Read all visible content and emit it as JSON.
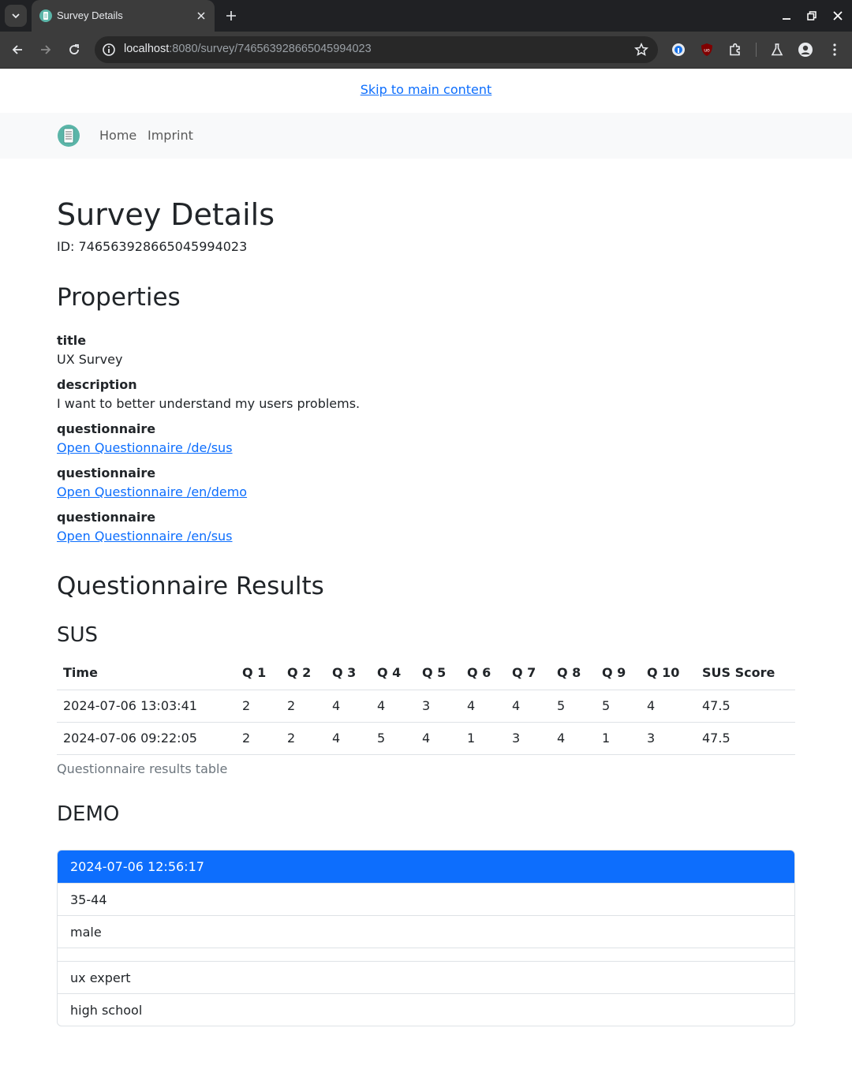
{
  "browser": {
    "tab_title": "Survey Details",
    "url_host": "localhost",
    "url_path": ":8080/survey/746563928665045994023"
  },
  "page": {
    "skip_link": "Skip to main content",
    "nav": {
      "home": "Home",
      "imprint": "Imprint"
    },
    "title": "Survey Details",
    "id_line": "ID: 746563928665045994023",
    "properties_heading": "Properties",
    "properties": [
      {
        "key": "title",
        "value": "UX Survey"
      },
      {
        "key": "description",
        "value": "I want to better understand my users problems."
      },
      {
        "key": "questionnaire",
        "link": "Open Questionnaire /de/sus"
      },
      {
        "key": "questionnaire",
        "link": "Open Questionnaire /en/demo"
      },
      {
        "key": "questionnaire",
        "link": "Open Questionnaire /en/sus"
      }
    ],
    "results_heading": "Questionnaire Results",
    "sus": {
      "heading": "SUS",
      "columns": [
        "Time",
        "Q 1",
        "Q 2",
        "Q 3",
        "Q 4",
        "Q 5",
        "Q 6",
        "Q 7",
        "Q 8",
        "Q 9",
        "Q 10",
        "SUS Score"
      ],
      "rows": [
        [
          "2024-07-06 13:03:41",
          "2",
          "2",
          "4",
          "4",
          "3",
          "4",
          "4",
          "5",
          "5",
          "4",
          "47.5"
        ],
        [
          "2024-07-06 09:22:05",
          "2",
          "2",
          "4",
          "5",
          "4",
          "1",
          "3",
          "4",
          "1",
          "3",
          "47.5"
        ]
      ],
      "caption": "Questionnaire results table"
    },
    "demo": {
      "heading": "DEMO",
      "items": [
        "2024-07-06 12:56:17",
        "35-44",
        "male",
        "",
        "ux expert",
        "high school"
      ]
    }
  },
  "colors": {
    "link": "#0d6efd",
    "active": "#0d6efd",
    "navbar_bg": "#f8f9fa",
    "brand_teal": "#5bb5a8"
  }
}
